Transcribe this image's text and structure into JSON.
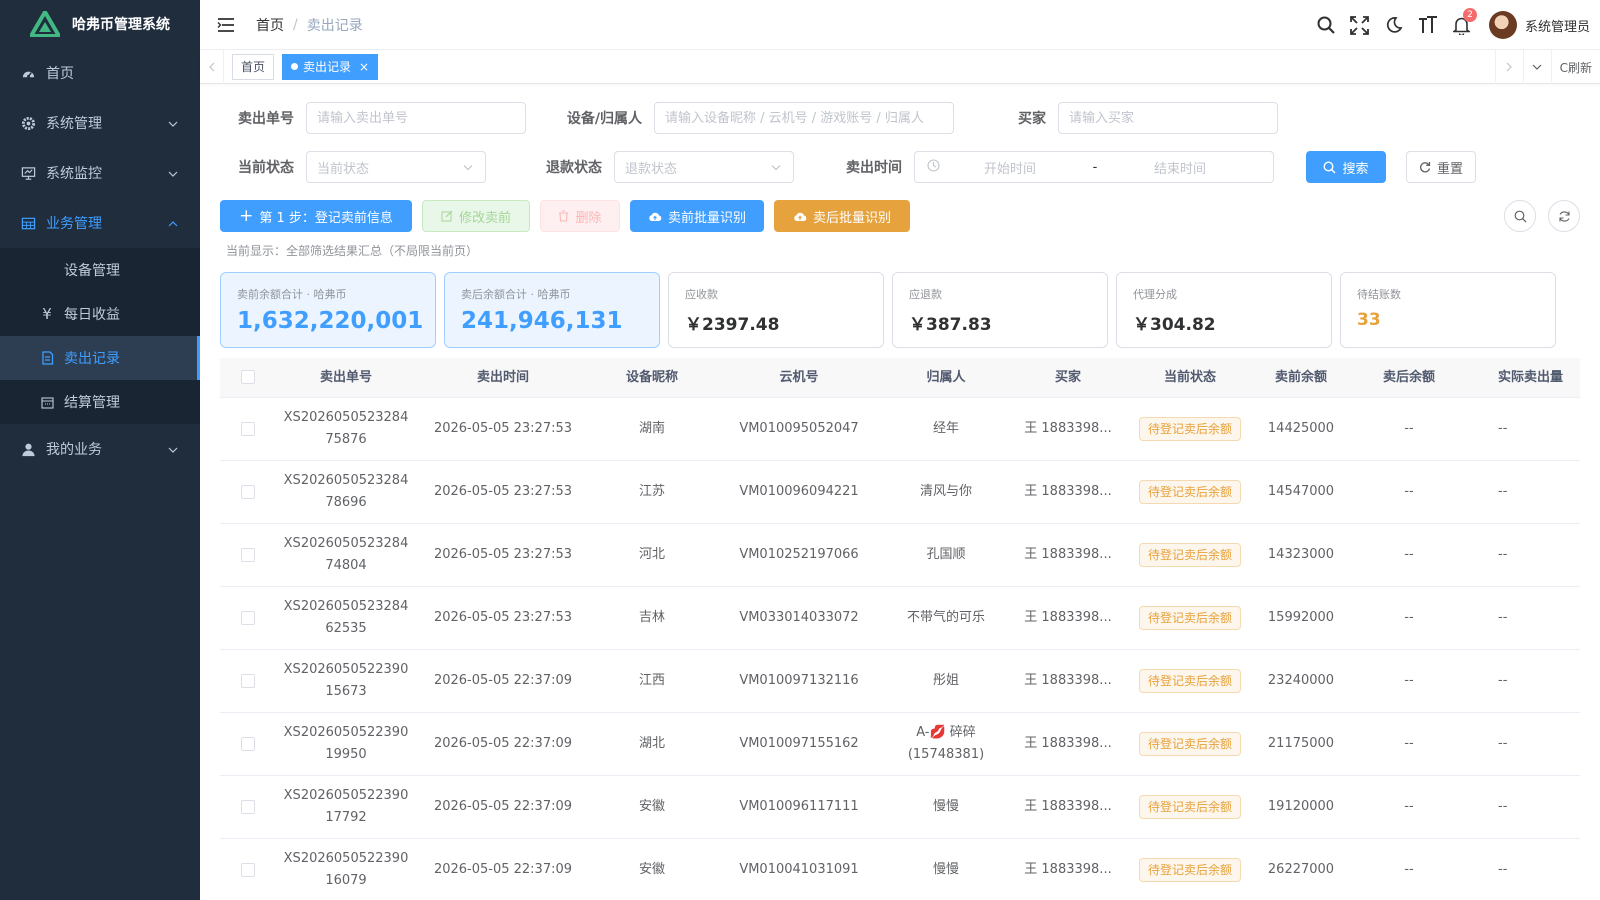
{
  "app": {
    "title": "哈弗币管理系统"
  },
  "sidebar": {
    "items": [
      {
        "label": "首页"
      },
      {
        "label": "系统管理"
      },
      {
        "label": "系统监控"
      },
      {
        "label": "业务管理"
      },
      {
        "label": "我的业务"
      }
    ],
    "submenu": [
      {
        "label": "设备管理"
      },
      {
        "label": "每日收益"
      },
      {
        "label": "卖出记录"
      },
      {
        "label": "结算管理"
      }
    ]
  },
  "header": {
    "breadcrumb": {
      "home": "首页",
      "separator": "/",
      "current": "卖出记录"
    },
    "notification_count": "2",
    "username": "系统管理员"
  },
  "tags": {
    "home": "首页",
    "active": "卖出记录",
    "close": "×",
    "refresh": "C刷新"
  },
  "filters": {
    "order_no": {
      "label": "卖出单号",
      "placeholder": "请输入卖出单号"
    },
    "device": {
      "label": "设备/归属人",
      "placeholder": "请输入设备昵称 / 云机号 / 游戏账号 / 归属人"
    },
    "buyer": {
      "label": "买家",
      "placeholder": "请输入买家"
    },
    "status": {
      "label": "当前状态",
      "placeholder": "当前状态"
    },
    "refund": {
      "label": "退款状态",
      "placeholder": "退款状态"
    },
    "time": {
      "label": "卖出时间",
      "start": "开始时间",
      "sep": "-",
      "end": "结束时间"
    },
    "search": "搜索",
    "reset": "重置"
  },
  "toolbar": {
    "step1": "第 1 步：登记卖前信息",
    "edit": "修改卖前",
    "delete": "删除",
    "batch_before": "卖前批量识别",
    "batch_after": "卖后批量识别"
  },
  "hint": "当前显示：全部筛选结果汇总（不局限当前页）",
  "stats": [
    {
      "label": "卖前余额合计 · 哈弗币",
      "value": "1,632,220,001"
    },
    {
      "label": "卖后余额合计 · 哈弗币",
      "value": "241,946,131"
    },
    {
      "label": "应收款",
      "value": "￥2397.48"
    },
    {
      "label": "应退款",
      "value": "￥387.83"
    },
    {
      "label": "代理分成",
      "value": "￥304.82"
    },
    {
      "label": "待结账数",
      "value": "33"
    }
  ],
  "table": {
    "headers": [
      "卖出单号",
      "卖出时间",
      "设备昵称",
      "云机号",
      "归属人",
      "买家",
      "当前状态",
      "卖前余额",
      "卖后余额",
      "实际卖出量"
    ],
    "rows": [
      {
        "no1": "XS2026050523284",
        "no2": "75876",
        "time": "2026-05-05 23:27:53",
        "device": "湖南",
        "cloud": "VM010095052047",
        "owner": "经年",
        "owner2": "",
        "buyer": "王 1883398...",
        "status": "待登记卖后余额",
        "before": "14425000",
        "after": "--",
        "actual": "--"
      },
      {
        "no1": "XS2026050523284",
        "no2": "78696",
        "time": "2026-05-05 23:27:53",
        "device": "江苏",
        "cloud": "VM010096094221",
        "owner": "清风与你",
        "owner2": "",
        "buyer": "王 1883398...",
        "status": "待登记卖后余额",
        "before": "14547000",
        "after": "--",
        "actual": "--"
      },
      {
        "no1": "XS2026050523284",
        "no2": "74804",
        "time": "2026-05-05 23:27:53",
        "device": "河北",
        "cloud": "VM010252197066",
        "owner": "孔国顺",
        "owner2": "",
        "buyer": "王 1883398...",
        "status": "待登记卖后余额",
        "before": "14323000",
        "after": "--",
        "actual": "--"
      },
      {
        "no1": "XS2026050523284",
        "no2": "62535",
        "time": "2026-05-05 23:27:53",
        "device": "吉林",
        "cloud": "VM033014033072",
        "owner": "不带气的可乐",
        "owner2": "",
        "buyer": "王 1883398...",
        "status": "待登记卖后余额",
        "before": "15992000",
        "after": "--",
        "actual": "--"
      },
      {
        "no1": "XS2026050522390",
        "no2": "15673",
        "time": "2026-05-05 22:37:09",
        "device": "江西",
        "cloud": "VM010097132116",
        "owner": "彤姐",
        "owner2": "",
        "buyer": "王 1883398...",
        "status": "待登记卖后余额",
        "before": "23240000",
        "after": "--",
        "actual": "--"
      },
      {
        "no1": "XS2026050522390",
        "no2": "19950",
        "time": "2026-05-05 22:37:09",
        "device": "湖北",
        "cloud": "VM010097155162",
        "owner": "A-💋 碎碎",
        "owner2": "(15748381)",
        "buyer": "王 1883398...",
        "status": "待登记卖后余额",
        "before": "21175000",
        "after": "--",
        "actual": "--"
      },
      {
        "no1": "XS2026050522390",
        "no2": "17792",
        "time": "2026-05-05 22:37:09",
        "device": "安徽",
        "cloud": "VM010096117111",
        "owner": "慢慢",
        "owner2": "",
        "buyer": "王 1883398...",
        "status": "待登记卖后余额",
        "before": "19120000",
        "after": "--",
        "actual": "--"
      },
      {
        "no1": "XS2026050522390",
        "no2": "16079",
        "time": "2026-05-05 22:37:09",
        "device": "安徽",
        "cloud": "VM010041031091",
        "owner": "慢慢",
        "owner2": "",
        "buyer": "王 1883398...",
        "status": "待登记卖后余额",
        "before": "26227000",
        "after": "--",
        "actual": "--"
      }
    ]
  }
}
